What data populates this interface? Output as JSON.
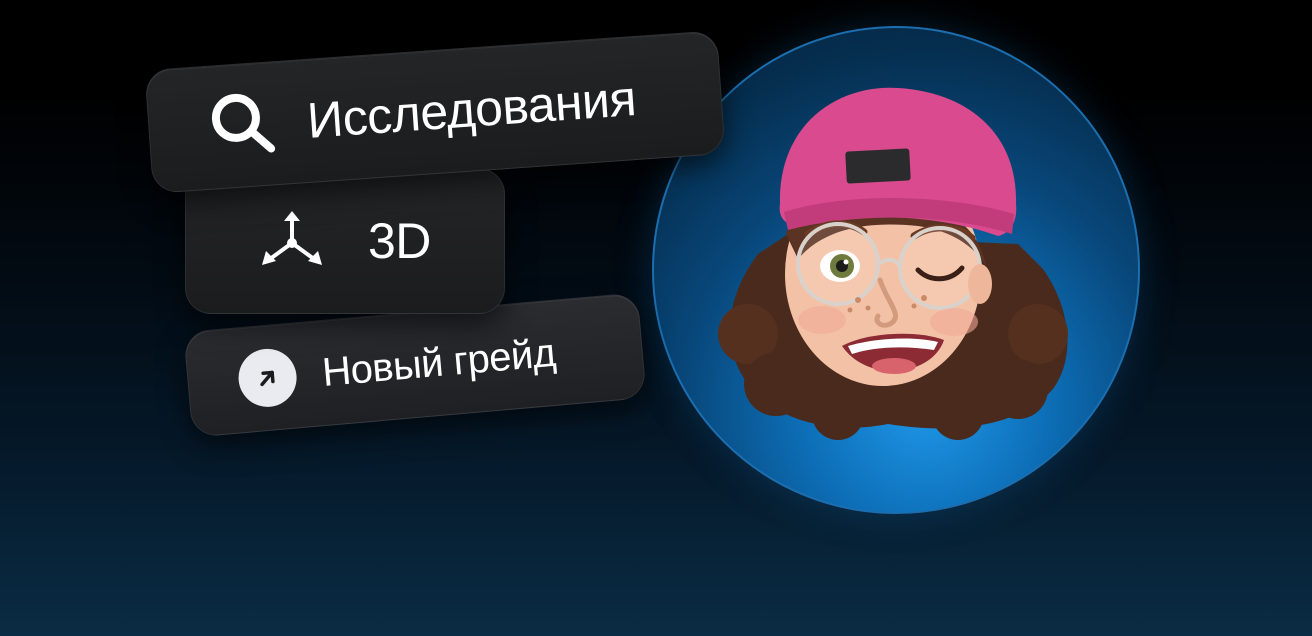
{
  "chips": {
    "research": {
      "label": "Исследования",
      "icon": "search-icon"
    },
    "three_d": {
      "label": "3D",
      "icon": "axes-3d-icon"
    },
    "new_grade": {
      "label": "Новый грейд",
      "icon": "arrow-up-right-icon"
    }
  },
  "avatar": {
    "icon": "memoji-avatar"
  },
  "colors": {
    "background_top": "#000000",
    "background_bottom": "#0a2c44",
    "chip_background": "#1f2022",
    "chip_text": "#ffffff",
    "ring_glow": "#1f97e8",
    "hat": "#d94b8e",
    "hair": "#4a2a1c",
    "arrow_badge": "#e9ebf0"
  }
}
